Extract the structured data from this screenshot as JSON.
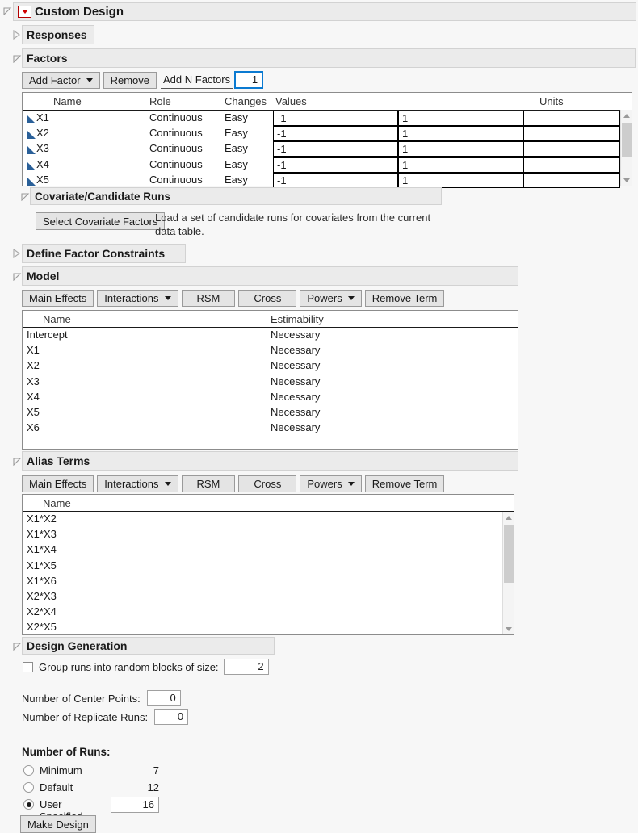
{
  "window": {
    "title": "Custom Design",
    "menu_icon": "red-triangle-menu-icon"
  },
  "sections": {
    "responses": {
      "title": "Responses",
      "collapsed": true
    },
    "factors": {
      "title": "Factors",
      "collapsed": false,
      "toolbar": {
        "add_factor": "Add Factor",
        "remove": "Remove",
        "add_n_factors_label": "Add N Factors",
        "add_n_factors_value": "1"
      },
      "columns": [
        "Name",
        "Role",
        "Changes",
        "Values",
        "",
        "Units"
      ],
      "rows": [
        {
          "name": "X1",
          "role": "Continuous",
          "changes": "Easy",
          "low": "-1",
          "high": "1",
          "units": ""
        },
        {
          "name": "X2",
          "role": "Continuous",
          "changes": "Easy",
          "low": "-1",
          "high": "1",
          "units": ""
        },
        {
          "name": "X3",
          "role": "Continuous",
          "changes": "Easy",
          "low": "-1",
          "high": "1",
          "units": ""
        },
        {
          "name": "X4",
          "role": "Continuous",
          "changes": "Easy",
          "low": "-1",
          "high": "1",
          "units": ""
        },
        {
          "name": "X5",
          "role": "Continuous",
          "changes": "Easy",
          "low": "-1",
          "high": "1",
          "units": ""
        }
      ]
    },
    "covariate": {
      "title": "Covariate/Candidate Runs",
      "collapsed": false,
      "button": "Select Covariate Factors",
      "description_line1": "Load a set of candidate runs for covariates from the current",
      "description_line2": "data table."
    },
    "constraints": {
      "title": "Define Factor Constraints",
      "collapsed": true
    },
    "model": {
      "title": "Model",
      "collapsed": false,
      "toolbar": [
        {
          "label": "Main Effects",
          "dropdown": false
        },
        {
          "label": "Interactions",
          "dropdown": true
        },
        {
          "label": "RSM",
          "dropdown": false
        },
        {
          "label": "Cross",
          "dropdown": false
        },
        {
          "label": "Powers",
          "dropdown": true
        },
        {
          "label": "Remove Term",
          "dropdown": false
        }
      ],
      "columns": [
        "Name",
        "Estimability"
      ],
      "rows": [
        {
          "name": "Intercept",
          "estimability": "Necessary"
        },
        {
          "name": "X1",
          "estimability": "Necessary"
        },
        {
          "name": "X2",
          "estimability": "Necessary"
        },
        {
          "name": "X3",
          "estimability": "Necessary"
        },
        {
          "name": "X4",
          "estimability": "Necessary"
        },
        {
          "name": "X5",
          "estimability": "Necessary"
        },
        {
          "name": "X6",
          "estimability": "Necessary"
        }
      ]
    },
    "alias": {
      "title": "Alias Terms",
      "collapsed": false,
      "toolbar": [
        {
          "label": "Main Effects",
          "dropdown": false
        },
        {
          "label": "Interactions",
          "dropdown": true
        },
        {
          "label": "RSM",
          "dropdown": false
        },
        {
          "label": "Cross",
          "dropdown": false
        },
        {
          "label": "Powers",
          "dropdown": true
        },
        {
          "label": "Remove Term",
          "dropdown": false
        }
      ],
      "columns": [
        "Name"
      ],
      "rows": [
        {
          "name": "X1*X2"
        },
        {
          "name": "X1*X3"
        },
        {
          "name": "X1*X4"
        },
        {
          "name": "X1*X5"
        },
        {
          "name": "X1*X6"
        },
        {
          "name": "X2*X3"
        },
        {
          "name": "X2*X4"
        },
        {
          "name": "X2*X5"
        }
      ]
    },
    "design_generation": {
      "title": "Design Generation",
      "collapsed": false,
      "group_runs_label": "Group runs into random blocks of size:",
      "group_runs_checked": false,
      "group_runs_value": "2",
      "center_points_label": "Number of Center Points:",
      "center_points_value": "0",
      "replicate_runs_label": "Number of Replicate Runs:",
      "replicate_runs_value": "0",
      "number_of_runs_label": "Number of Runs:",
      "run_options": [
        {
          "label": "Minimum",
          "value": "7",
          "selected": false,
          "editable": false
        },
        {
          "label": "Default",
          "value": "12",
          "selected": false,
          "editable": false
        },
        {
          "label": "User Specified",
          "value": "16",
          "selected": true,
          "editable": true
        }
      ],
      "make_design": "Make Design"
    }
  }
}
